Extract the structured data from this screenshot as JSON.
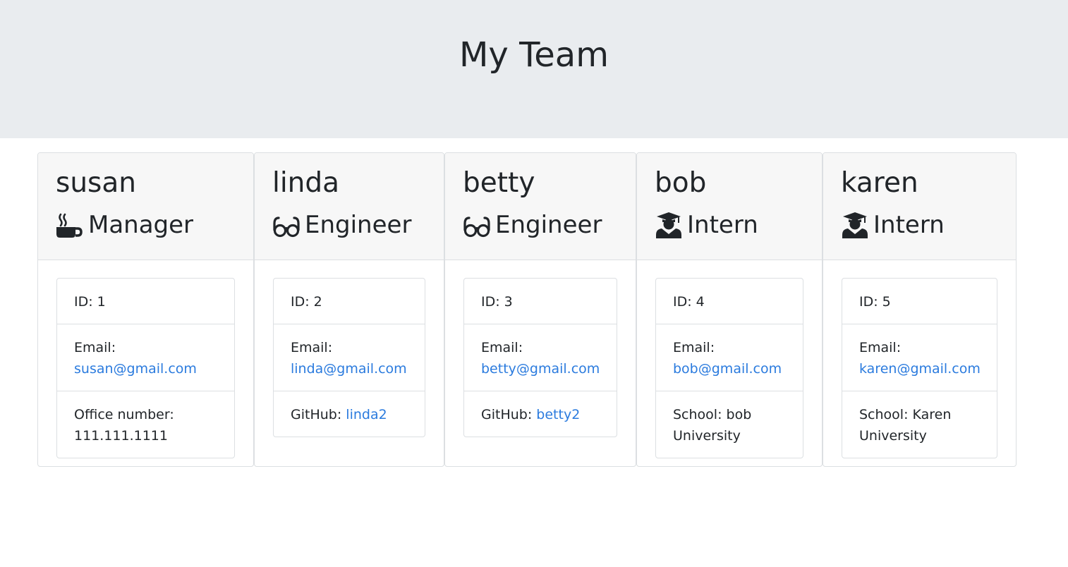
{
  "header": {
    "title": "My Team"
  },
  "team": [
    {
      "name": "susan",
      "role": "Manager",
      "role_icon": "coffee-icon",
      "id_label": "ID: 1",
      "email_label": "Email:",
      "email": "susan@gmail.com",
      "extra_label": "Office number:",
      "extra_value": "111.111.1111"
    },
    {
      "name": "linda",
      "role": "Engineer",
      "role_icon": "glasses-icon",
      "id_label": "ID: 2",
      "email_label": "Email:",
      "email": "linda@gmail.com",
      "extra_label": "GitHub:",
      "extra_value": "linda2"
    },
    {
      "name": "betty",
      "role": "Engineer",
      "role_icon": "glasses-icon",
      "id_label": "ID: 3",
      "email_label": "Email:",
      "email": "betty@gmail.com",
      "extra_label": "GitHub:",
      "extra_value": "betty2"
    },
    {
      "name": "bob",
      "role": "Intern",
      "role_icon": "graduate-icon",
      "id_label": "ID: 4",
      "email_label": "Email:",
      "email": "bob@gmail.com",
      "extra_label": "School: bob",
      "extra_value": "University"
    },
    {
      "name": "karen",
      "role": "Intern",
      "role_icon": "graduate-icon",
      "id_label": "ID: 5",
      "email_label": "Email:",
      "email": "karen@gmail.com",
      "extra_label": "School: Karen",
      "extra_value": "University"
    }
  ],
  "colors": {
    "jumbotron_bg": "#e9ecef",
    "card_header_bg": "#f7f7f7",
    "link": "#2b7bde",
    "text": "#212529"
  }
}
